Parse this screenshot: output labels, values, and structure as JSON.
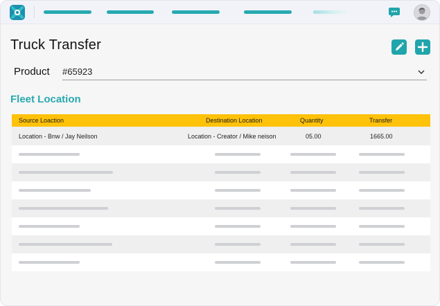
{
  "page": {
    "title": "Truck Transfer",
    "product_label": "Product",
    "product_value": "#65923",
    "section_title": "Fleet Location"
  },
  "table": {
    "headers": [
      "Source Loaction",
      "Destination Location",
      "Quantity",
      "Transfer"
    ],
    "rows": [
      {
        "source": "Location - Bnw / Jay Neilson",
        "destination": "Location - Creator / Mike neison",
        "quantity": "05.00",
        "transfer": "1665.00"
      }
    ]
  },
  "colors": {
    "accent": "#26a9b0",
    "header": "#ffc20a"
  },
  "icons": [
    "app-logo-icon",
    "chat-icon",
    "avatar",
    "edit-icon",
    "plus-icon",
    "chevron-down-icon"
  ]
}
